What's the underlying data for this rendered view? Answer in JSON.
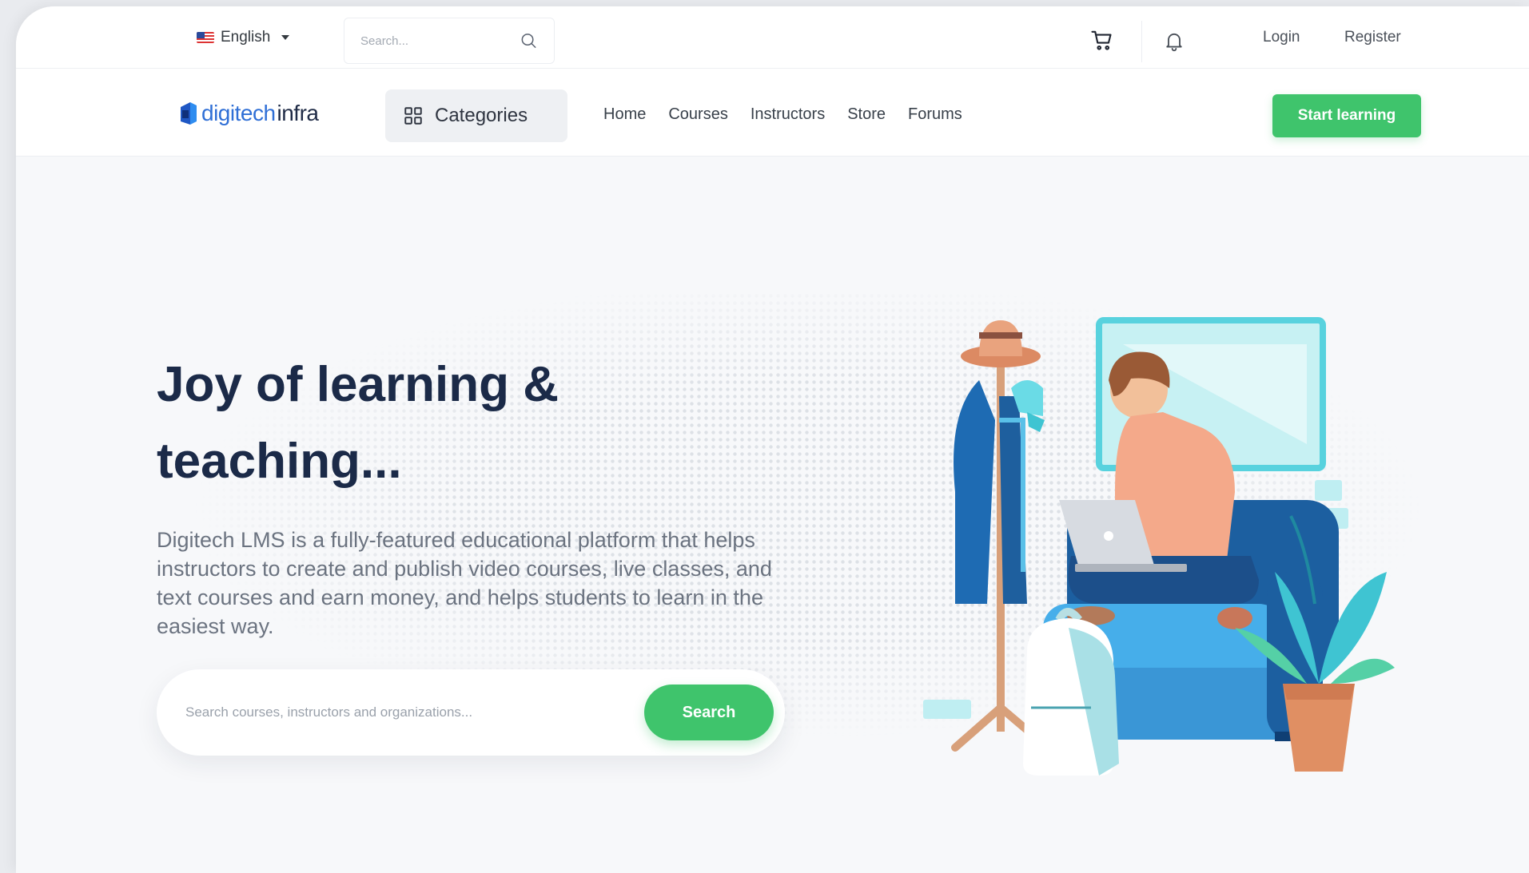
{
  "topbar": {
    "language": "English",
    "search_placeholder": "Search...",
    "login": "Login",
    "register": "Register"
  },
  "navbar": {
    "logo_part1": "digitech",
    "logo_part2": "infra",
    "categories_label": "Categories",
    "links": [
      "Home",
      "Courses",
      "Instructors",
      "Store",
      "Forums"
    ],
    "cta": "Start learning"
  },
  "hero": {
    "headline_line1": "Joy of learning &",
    "headline_line2": "teaching...",
    "description": "Digitech LMS is a fully-featured educational platform that helps instructors to create and publish video courses, live classes, and text courses and earn money, and helps students to learn in the easiest way.",
    "search_placeholder": "Search courses, instructors and organizations...",
    "search_button": "Search"
  },
  "colors": {
    "primary_green": "#3fc46c",
    "brand_blue": "#2f6fd6",
    "heading_navy": "#1b2a48"
  },
  "icons": [
    "us-flag-icon",
    "chevron-down-icon",
    "search-icon",
    "cart-icon",
    "bell-icon",
    "grid-icon",
    "logo-icon"
  ]
}
